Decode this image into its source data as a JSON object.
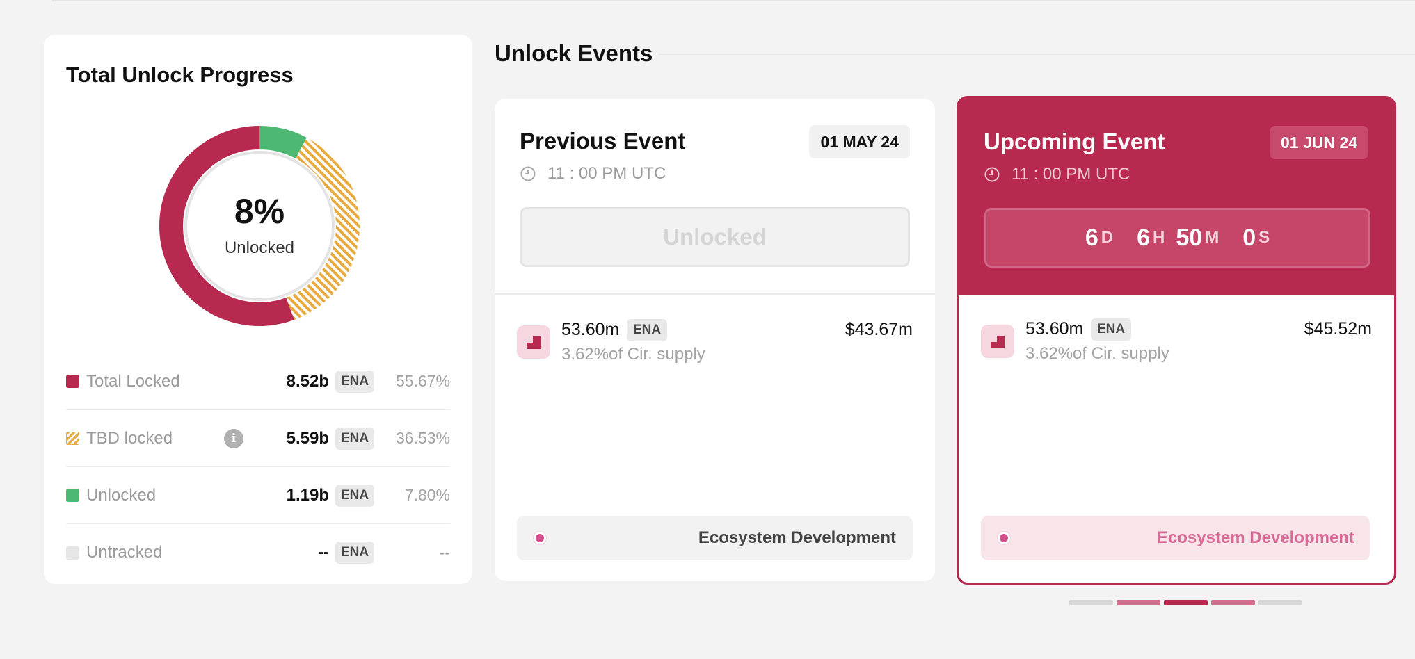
{
  "progress": {
    "title": "Total Unlock Progress",
    "percent_text": "8%",
    "percent_label": "Unlocked",
    "unlocked_fraction": 0.078,
    "legend": [
      {
        "label": "Total Locked",
        "amount": "8.52b",
        "token": "ENA",
        "share": "55.67%",
        "fraction": 0.5567,
        "color": "#b8294f"
      },
      {
        "label": "TBD locked",
        "amount": "5.59b",
        "token": "ENA",
        "share": "36.53%",
        "fraction": 0.3653,
        "color": "#e9a93c"
      },
      {
        "label": "Unlocked",
        "amount": "1.19b",
        "token": "ENA",
        "share": "7.80%",
        "fraction": 0.078,
        "color": "#4cb872"
      },
      {
        "label": "Untracked",
        "amount": "--",
        "token": "ENA",
        "share": "--",
        "color": "#e6e6e6"
      }
    ]
  },
  "events": {
    "title": "Unlock Events",
    "previous": {
      "title": "Previous Event",
      "date": "01 MAY 24",
      "time": "11 : 00 PM UTC",
      "status": "Unlocked",
      "amount": "53.60m",
      "token": "ENA",
      "usd": "$43.67m",
      "supply": "3.62%of Cir. supply",
      "category": "Ecosystem Development"
    },
    "upcoming": {
      "title": "Upcoming Event",
      "date": "01 JUN 24",
      "time": "11 : 00 PM UTC",
      "countdown": {
        "days": "6",
        "days_unit": "D",
        "hours": "6",
        "hours_unit": "H",
        "minutes": "50",
        "minutes_unit": "M",
        "seconds": "0",
        "seconds_unit": "S"
      },
      "amount": "53.60m",
      "token": "ENA",
      "usd": "$45.52m",
      "supply": "3.62%of Cir. supply",
      "category": "Ecosystem Development"
    }
  },
  "colors": {
    "accent": "#b8294f",
    "unlocked": "#4cb872",
    "tbd": "#e9a93c",
    "category_dot": "#d44f8c"
  },
  "pager": {
    "count": 5,
    "active_index": 2
  }
}
